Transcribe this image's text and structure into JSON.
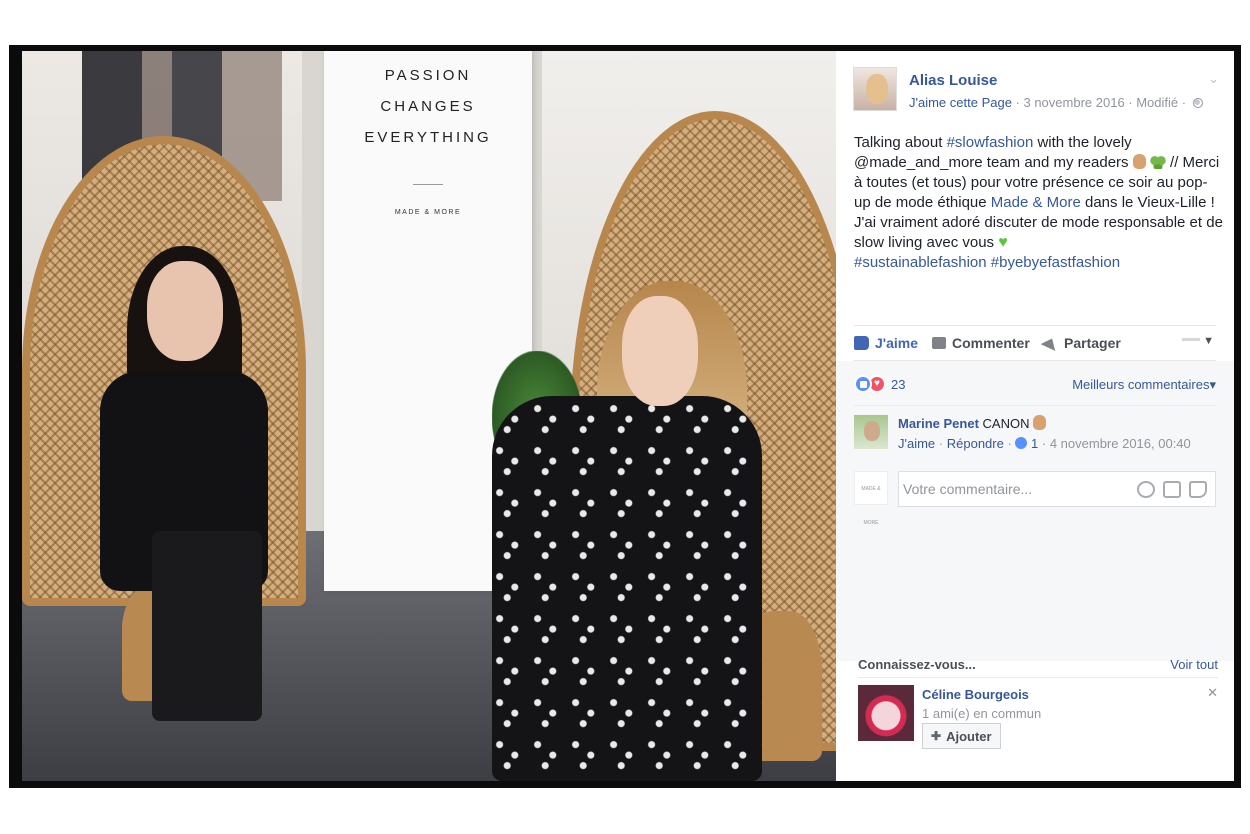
{
  "photo": {
    "banner_lines": [
      "PASSION",
      "CHANGES",
      "EVERYTHING"
    ],
    "banner_brand": "MADE & MORE"
  },
  "post": {
    "author": "Alias Louise",
    "page_like": "J'aime cette Page",
    "meta_rest": " · 3 novembre 2016 · Modifié · ",
    "text": {
      "p1": "Talking about ",
      "hashtag1": "#slowfashion",
      "p2": " with the lovely @made_and_more team and my readers ",
      "p3": " // Merci à toutes (et tous) pour votre présence ce soir au pop-up de mode éthique ",
      "link": "Made & More",
      "p4": " dans le Vieux-Lille ! J'ai vraiment adoré discuter de mode responsable et de slow living avec vous ",
      "hashtag2": "#sustainablefashion",
      "hashtag3": "#byebyefastfashion"
    }
  },
  "actions": {
    "like": "J'aime",
    "comment": "Commenter",
    "share": "Partager"
  },
  "reactions": {
    "count": "23",
    "top_comments": "Meilleurs commentaires"
  },
  "comment": {
    "author": "Marine Penet",
    "text": "CANON",
    "like": "J'aime",
    "reply": "Répondre",
    "likes": "1",
    "date": "4 novembre 2016, 00:40"
  },
  "compose": {
    "placeholder": "Votre commentaire...",
    "avatar_text": "MADE & MORE"
  },
  "pymk": {
    "title": "Connaissez-vous...",
    "see_all": "Voir tout",
    "name": "Céline Bourgeois",
    "mutual": "1 ami(e) en commun",
    "add": "Ajouter"
  },
  "colors": {
    "link": "#365899",
    "like_blue": "#4267b2",
    "love_red": "#f25268"
  }
}
